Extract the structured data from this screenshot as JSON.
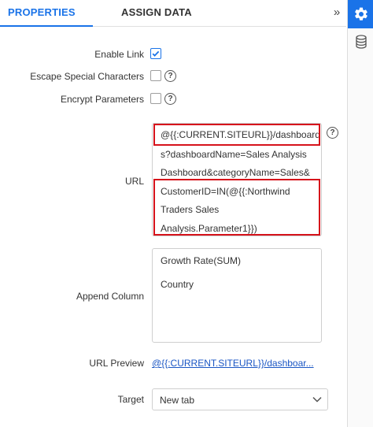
{
  "tabs": {
    "properties": "PROPERTIES",
    "assign_data": "ASSIGN DATA",
    "collapse_icon": "»"
  },
  "rightbar": {
    "icons": [
      "gear-icon",
      "database-icon"
    ],
    "active_color": "#1a73e8"
  },
  "form": {
    "enable_link": {
      "label": "Enable Link",
      "checked": true
    },
    "escape_special_characters": {
      "label": "Escape Special Characters",
      "checked": false
    },
    "encrypt_parameters": {
      "label": "Encrypt Parameters",
      "checked": false
    },
    "help_glyph": "?",
    "url": {
      "label": "URL",
      "lines": [
        "@{{:CURRENT.SITEURL}}/dashboard",
        "s?dashboardName=Sales Analysis",
        "Dashboard&categoryName=Sales&",
        "CustomerID=IN(@{{:Northwind",
        "Traders Sales",
        "Analysis.Parameter1}})"
      ],
      "highlight_color": "#d6121b"
    },
    "append_column": {
      "label": "Append Column",
      "items": [
        "Growth Rate(SUM)",
        "Country"
      ]
    },
    "url_preview": {
      "label": "URL Preview",
      "value": "@{{:CURRENT.SITEURL}}/dashboar..."
    },
    "target": {
      "label": "Target",
      "selected": "New tab"
    }
  }
}
